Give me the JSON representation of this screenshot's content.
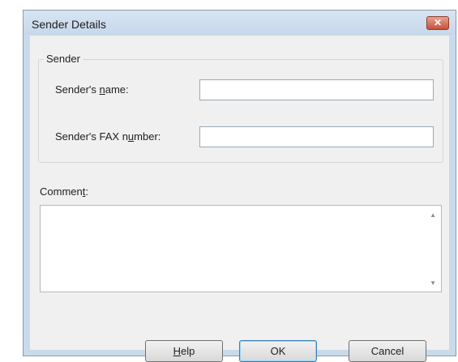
{
  "dialog": {
    "title": "Sender Details",
    "close_icon": "close-icon"
  },
  "sender_group": {
    "legend": "Sender",
    "name_label": {
      "pre": "Sender's ",
      "key": "n",
      "post": "ame:"
    },
    "name_value": "",
    "fax_label": {
      "pre": "Sender's FAX n",
      "key": "u",
      "post": "mber:"
    },
    "fax_value": ""
  },
  "comment": {
    "label": {
      "pre": "Commen",
      "key": "t",
      "post": ":"
    },
    "value": "",
    "scroll_up_icon": "scroll-up-arrow-icon",
    "scroll_down_icon": "scroll-down-arrow-icon"
  },
  "buttons": {
    "help": {
      "key": "H",
      "post": "elp"
    },
    "ok": "OK",
    "cancel": "Cancel"
  },
  "colors": {
    "frame": "#c9daea",
    "client": "#f0f0f0",
    "close_button": "#c8513a",
    "default_button_border": "#3c7fb1"
  }
}
